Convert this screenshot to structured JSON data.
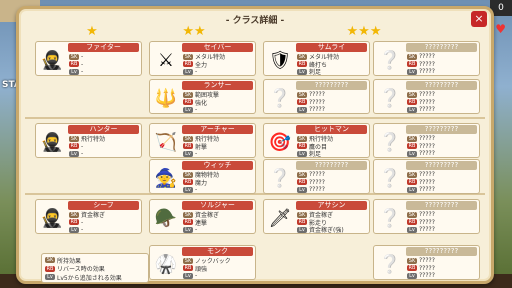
{
  "background": {
    "left_label": "STA",
    "right_count": "0"
  },
  "panel": {
    "title": "- クラス詳細 -",
    "close_label": "×"
  },
  "tiers": [
    "★",
    "★★",
    "★★★"
  ],
  "cards": {
    "fighter": {
      "name": "ファイター",
      "skills": [
        "-",
        "-",
        "-"
      ]
    },
    "saber": {
      "name": "セイバー",
      "skills": [
        "メタル特効",
        "全力",
        "-"
      ]
    },
    "samurai": {
      "name": "サムライ",
      "skills": [
        "メタル特効",
        "峰打ち",
        "刺足"
      ]
    },
    "unk1": {
      "name": "?????????",
      "skills": [
        "?????",
        "?????",
        "?????"
      ]
    },
    "lancer": {
      "name": "ランサー",
      "skills": [
        "範囲攻撃",
        "強化",
        "-"
      ]
    },
    "unk2": {
      "name": "?????????",
      "skills": [
        "?????",
        "?????",
        "?????"
      ]
    },
    "unk3": {
      "name": "?????????",
      "skills": [
        "?????",
        "?????",
        "?????"
      ]
    },
    "hunter": {
      "name": "ハンター",
      "skills": [
        "飛行特効",
        "-",
        "-"
      ]
    },
    "archer": {
      "name": "アーチャー",
      "skills": [
        "飛行特効",
        "射撃",
        "-"
      ]
    },
    "hitman": {
      "name": "ヒットマン",
      "skills": [
        "飛行特効",
        "鷹の目",
        "刺足"
      ]
    },
    "unk4": {
      "name": "?????????",
      "skills": [
        "?????",
        "?????",
        "?????"
      ]
    },
    "witch": {
      "name": "ウィッチ",
      "skills": [
        "魔物特効",
        "魔力",
        "-"
      ]
    },
    "unk5": {
      "name": "?????????",
      "skills": [
        "?????",
        "?????",
        "?????"
      ]
    },
    "unk6": {
      "name": "?????????",
      "skills": [
        "?????",
        "?????",
        "?????"
      ]
    },
    "thief": {
      "name": "シーフ",
      "skills": [
        "資金稼ぎ",
        "-",
        "-"
      ]
    },
    "soldier": {
      "name": "ソルジャー",
      "skills": [
        "資金稼ぎ",
        "連撃",
        "-"
      ]
    },
    "assassin": {
      "name": "アサシン",
      "skills": [
        "資金稼ぎ",
        "影走り",
        "資金稼ぎ(強)"
      ]
    },
    "unk7": {
      "name": "?????????",
      "skills": [
        "?????",
        "?????",
        "?????"
      ]
    },
    "monk": {
      "name": "モンク",
      "skills": [
        "ノックバック",
        "頑強",
        "-"
      ]
    },
    "unk8": {
      "name": "?????????",
      "skills": [
        "?????",
        "?????",
        "?????"
      ]
    }
  },
  "legend": [
    "所持効果",
    "リバース時の効果",
    "Lv5から追加される効果"
  ],
  "tags": {
    "sk": "SK",
    "rb": "RB",
    "lv": "Lv"
  }
}
